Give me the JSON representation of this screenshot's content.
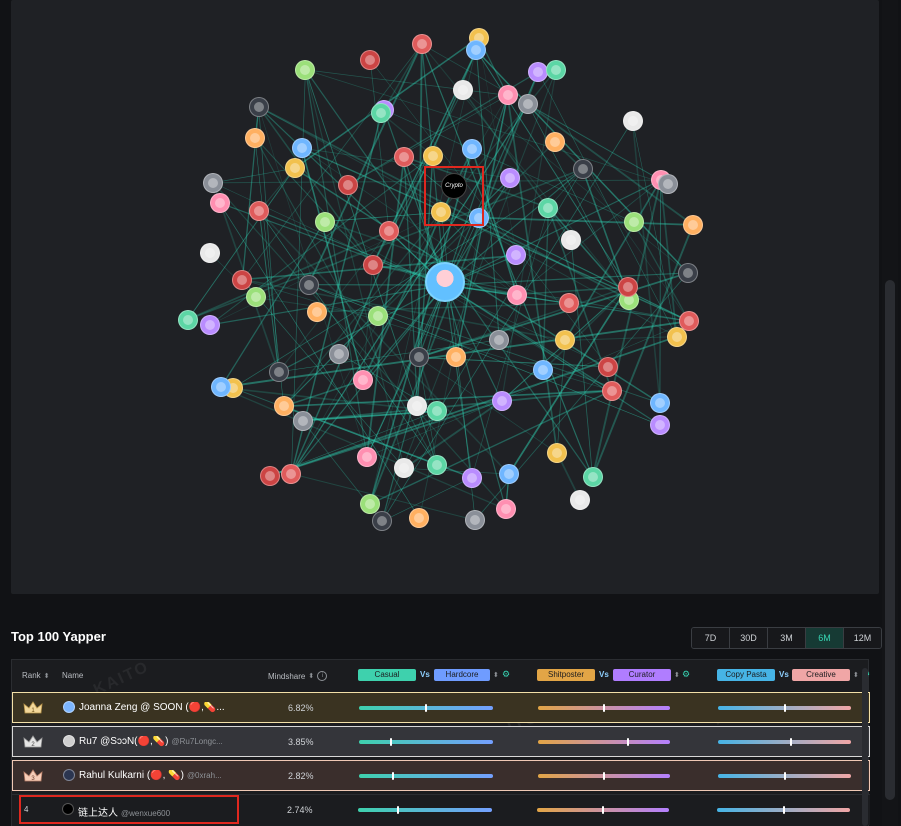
{
  "network": {
    "crypto_node_label": "Crypto"
  },
  "section": {
    "title": "Top 100 Yapper",
    "ranges": [
      "7D",
      "30D",
      "3M",
      "6M",
      "12M"
    ],
    "active_range": "6M"
  },
  "table": {
    "headers": {
      "rank": "Rank",
      "name": "Name",
      "mindshare": "Mindshare"
    },
    "comparisons": [
      {
        "left": "Casual",
        "right": "Hardcore",
        "vs": "Vs",
        "left_color": "#3ed1ad",
        "right_color": "#6f9cff"
      },
      {
        "left": "Shitposter",
        "right": "Curator",
        "vs": "Vs",
        "left_color": "#e2a546",
        "right_color": "#b07dff"
      },
      {
        "left": "Copy Pasta",
        "right": "Creative",
        "vs": "Vs",
        "left_color": "#46b4e6",
        "right_color": "#f0a6a6"
      }
    ],
    "rows": [
      {
        "rank": "1",
        "name": "Joanna Zeng @ SOON (🔴,💊...",
        "handle": "",
        "mindshare": "6.82%",
        "scores": [
          0.5,
          0.5,
          0.5
        ]
      },
      {
        "rank": "2",
        "name": "Ru7 @SɔɔN(🔴,💊)",
        "handle": "@Ru7Longc...",
        "mindshare": "3.85%",
        "scores": [
          0.24,
          0.68,
          0.55
        ]
      },
      {
        "rank": "3",
        "name": "Rahul Kulkarni (🔴, 💊)",
        "handle": "@0xrah...",
        "mindshare": "2.82%",
        "scores": [
          0.25,
          0.5,
          0.5
        ]
      },
      {
        "rank": "4",
        "name": "链上达人",
        "handle": "@wenxue600",
        "mindshare": "2.74%",
        "scores": [
          0.3,
          0.5,
          0.5
        ]
      }
    ]
  },
  "watermark": "KAITO"
}
